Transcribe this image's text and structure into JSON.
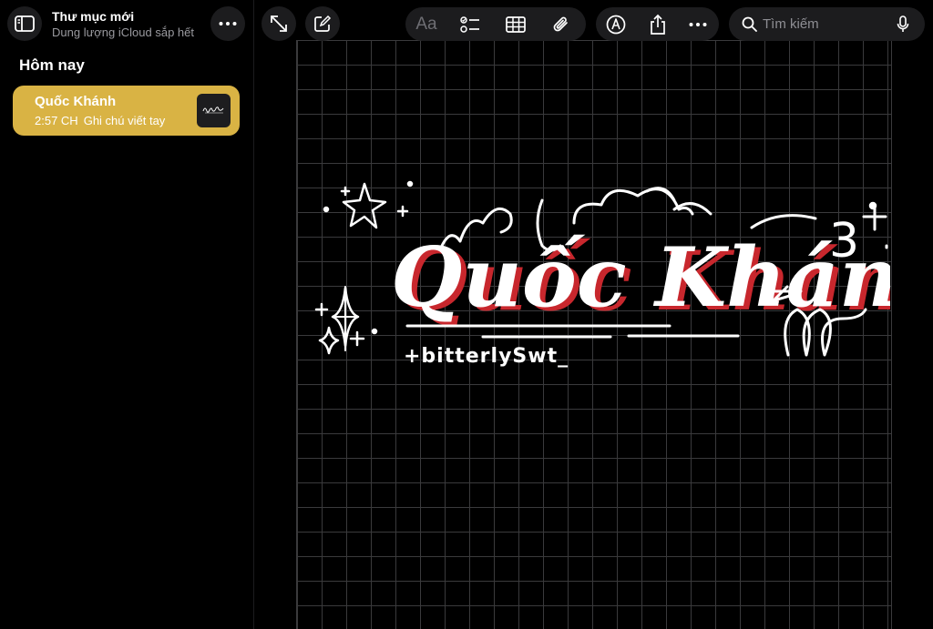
{
  "sidebar": {
    "folder_title": "Thư mục mới",
    "folder_subtitle": "Dung lượng iCloud sắp hết",
    "section_title": "Hôm nay",
    "notes": [
      {
        "title": "Quốc Khánh",
        "time": "2:57 CH",
        "type": "Ghi chú viết tay"
      }
    ]
  },
  "toolbar": {
    "format_label": "Aa",
    "search_placeholder": "Tìm kiếm"
  },
  "drawing": {
    "handwriting_main": "Quốc Khánh",
    "handwriting_signature": "+bitterlySwt_",
    "handwriting_number": "3"
  },
  "colors": {
    "accent_yellow": "#d9b344",
    "background": "#000000",
    "button_bg": "#1c1c1e",
    "grid_line": "#3a3a3c",
    "shadow_red": "#c8272d"
  },
  "icons": [
    "sidebar-toggle-icon",
    "more-icon",
    "expand-icon",
    "compose-icon",
    "checklist-icon",
    "table-icon",
    "paperclip-icon",
    "markup-pen-icon",
    "share-icon",
    "search-icon",
    "mic-icon"
  ]
}
